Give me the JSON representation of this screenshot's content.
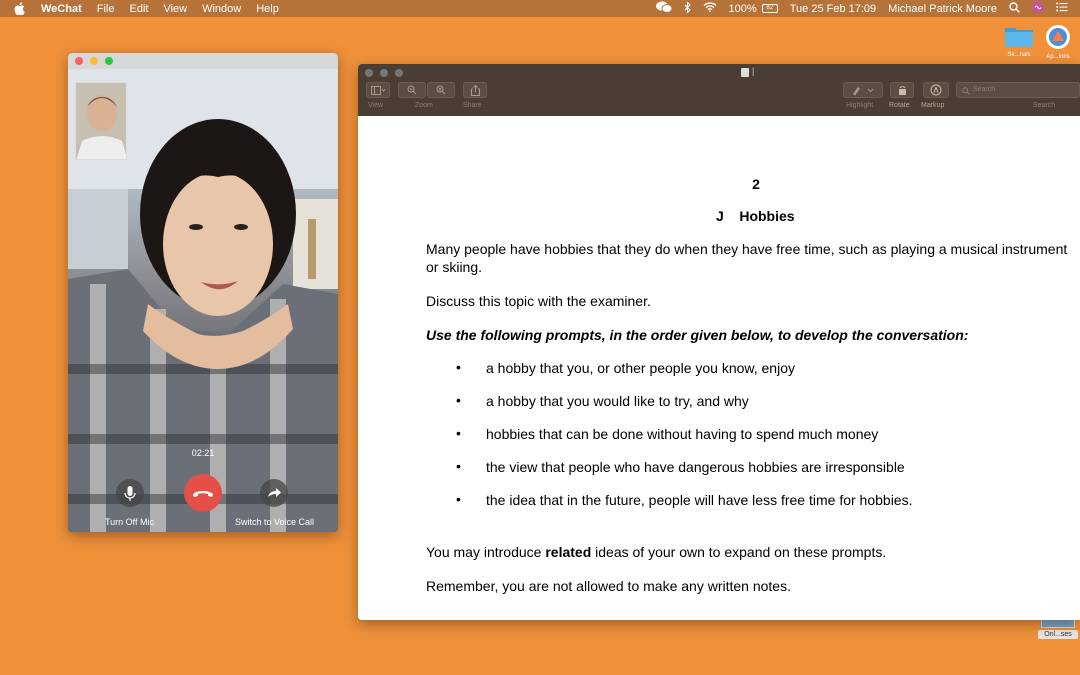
{
  "menubar": {
    "app_name": "WeChat",
    "menus": [
      "File",
      "Edit",
      "View",
      "Window",
      "Help"
    ],
    "battery": "100%",
    "battery_icon_text": "82",
    "datetime": "Tue 25 Feb  17:09",
    "user": "Michael Patrick Moore"
  },
  "desktop": {
    "icons": [
      {
        "label": "Se...nals",
        "icon": "folder-icon"
      },
      {
        "label": "Ap...ions",
        "icon": "app-icon"
      },
      {
        "label": "Onl...ses",
        "icon": "image-file-icon"
      }
    ]
  },
  "call": {
    "timer": "02:21",
    "mic_label": "Turn Off Mic",
    "voice_label": "Switch to Voice Call",
    "colors": {
      "end": "#e45048",
      "close": "#fe5f57",
      "min": "#febc2e",
      "max": "#28c840"
    }
  },
  "preview": {
    "title": "|",
    "toolbar": {
      "view": "View",
      "zoom": "Zoom",
      "share": "Share",
      "highlight": "Highlight",
      "rotate": "Rotate",
      "markup": "Markup",
      "search_placeholder": "Search",
      "search_label": "Search"
    },
    "document": {
      "page_number": "2",
      "heading": "J    Hobbies",
      "intro_line1": "Many people have hobbies that they do when they have free time, such as playing a musical instrument",
      "intro_line2": "or skiing.",
      "discuss": "Discuss this topic with the examiner.",
      "instruction": "Use the following prompts, in the order given below, to develop the conversation:",
      "bullet_char": "•",
      "prompts": [
        "a hobby that you, or other people you know, enjoy",
        "a hobby that you would like to try, and why",
        "hobbies that can be done without having to spend much money",
        "the view that people who have dangerous hobbies are irresponsible",
        "the idea that in the future, people will have less free time for hobbies."
      ],
      "closing_before": "You may introduce ",
      "closing_bold": "related",
      "closing_after": " ideas of your own to expand on these prompts.",
      "reminder": "Remember, you are not allowed to make any written notes."
    }
  }
}
